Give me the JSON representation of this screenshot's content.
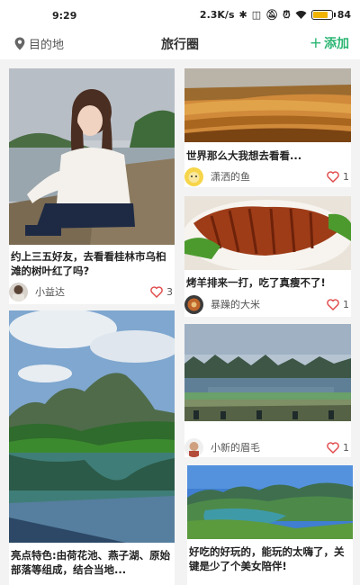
{
  "status_bar": {
    "time": "9:29",
    "speed": "2.3K/s",
    "battery": "84",
    "battery_level": 0.84,
    "icons": [
      "bluetooth-icon",
      "nfc-icon",
      "mute-icon",
      "alarm-icon",
      "wifi-icon",
      "battery-icon"
    ]
  },
  "header": {
    "destination_label": "目的地",
    "title": "旅行圈",
    "add_label": "添加",
    "accent_color": "#2bb673"
  },
  "posts": [
    {
      "title": "约上三五好友，去看看桂林市乌桕滩的树叶红了吗?",
      "user": "小益达",
      "likes": "3"
    },
    {
      "title": "世界那么大我想去看看...",
      "user": "潇洒的鱼",
      "likes": "1"
    },
    {
      "title": "烤羊排来一打，吃了真瘦不了!",
      "user": "暴躁的大米",
      "likes": "1"
    },
    {
      "title": "",
      "user": "小新的眉毛",
      "likes": "1"
    },
    {
      "title": "亮点特色:由荷花池、燕子湖、原始部落等组成，结合当地...",
      "user": "",
      "likes": ""
    },
    {
      "title": "好吃的好玩的，能玩的太嗨了，关键是少了个美女陪伴!",
      "user": "",
      "likes": ""
    }
  ],
  "colors": {
    "heart": "#e04848",
    "background": "#f3f3f3"
  }
}
